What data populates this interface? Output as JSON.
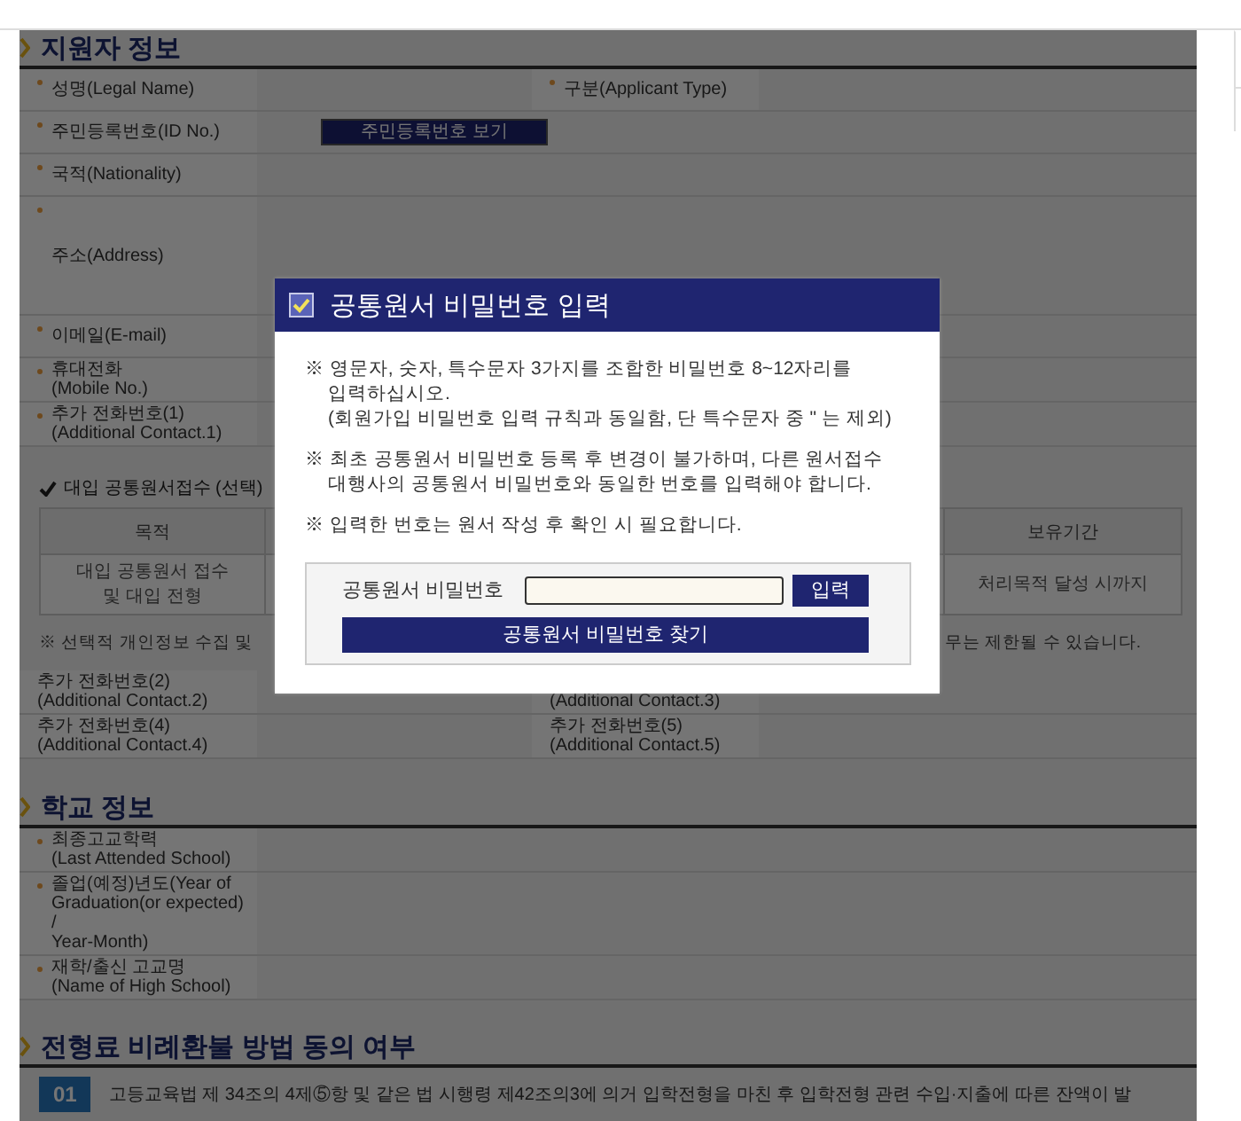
{
  "applicant_section": {
    "title": "지원자 정보",
    "rows": [
      {
        "kind": "double",
        "fields": [
          {
            "label": "성명(Legal Name)",
            "required": true
          },
          {
            "label": "구분(Applicant Type)",
            "required": true
          }
        ]
      },
      {
        "kind": "single",
        "fields": [
          {
            "label": "주민등록번호(ID No.)",
            "required": true,
            "button": "주민등록번호 보기"
          }
        ]
      },
      {
        "kind": "single",
        "fields": [
          {
            "label": "국적(Nationality)",
            "required": true
          }
        ]
      },
      {
        "kind": "tall",
        "fields": [
          {
            "label": "주소(Address)",
            "required": true
          }
        ]
      },
      {
        "kind": "single",
        "fields": [
          {
            "label": "이메일(E-mail)",
            "required": true
          }
        ]
      },
      {
        "kind": "single",
        "fields": [
          {
            "label": "휴대전화\n(Mobile No.)",
            "required": true
          }
        ]
      },
      {
        "kind": "single",
        "fields": [
          {
            "label": "추가 전화번호(1)\n(Additional Contact.1)",
            "required": true
          }
        ]
      }
    ]
  },
  "consent": {
    "title": "대입 공통원서접수 (선택)",
    "columns": [
      "목적",
      "보유기간"
    ],
    "rows": [
      [
        "대입 공통원서 접수\n및 대입 전형",
        "처리목적 달성 시까지"
      ]
    ],
    "notice_start": "※ 선택적 개인정보 수집 및",
    "notice_end": "무는 제한될 수 있습니다.",
    "rows_after": [
      {
        "kind": "double",
        "fields": [
          {
            "label": "추가 전화번호(2)\n(Additional Contact.2)",
            "required": false
          },
          {
            "label": "(Additional Contact.3)",
            "required": false
          }
        ]
      },
      {
        "kind": "double",
        "fields": [
          {
            "label": "추가 전화번호(4)\n(Additional Contact.4)",
            "required": false
          },
          {
            "label": "추가 전화번호(5)\n(Additional Contact.5)",
            "required": false
          }
        ]
      }
    ]
  },
  "school_section": {
    "title": "학교 정보",
    "rows": [
      {
        "kind": "single",
        "fields": [
          {
            "label": "최종고교학력\n(Last Attended School)",
            "required": true
          }
        ]
      },
      {
        "kind": "single",
        "fields": [
          {
            "label": "졸업(예정)년도(Year of\nGraduation(or expected)\n/\nYear-Month)",
            "required": true
          }
        ]
      },
      {
        "kind": "single",
        "fields": [
          {
            "label": "재학/출신 고교명\n(Name of High School)",
            "required": true
          }
        ]
      }
    ]
  },
  "refund_section": {
    "title": "전형료 비례환불 방법 동의 여부",
    "items": [
      {
        "number": "01",
        "text": "고등교육법 제 34조의 4제⑤항 및 같은 법 시행령 제42조의3에 의거 입학전형을 마친 후 입학전형 관련 수입·지출에 따른 잔액이 발"
      }
    ]
  },
  "modal": {
    "title": "공통원서 비밀번호 입력",
    "notes": [
      "※ 영문자, 숫자, 특수문자 3가지를 조합한 비밀번호 8~12자리를\n입력하십시오.\n(회원가입 비밀번호 입력 규칙과 동일함, 단 특수문자 중 \" 는 제외)",
      "※ 최초 공통원서 비밀번호 등록 후 변경이 불가하며, 다른 원서접수\n대행사의 공통원서 비밀번호와 동일한 번호를 입력해야 합니다.",
      "※ 입력한 번호는 원서 작성 후 확인 시 필요합니다."
    ],
    "password_label": "공통원서 비밀번호",
    "submit_button": "입력",
    "find_button": "공통원서 비밀번호 찾기"
  }
}
